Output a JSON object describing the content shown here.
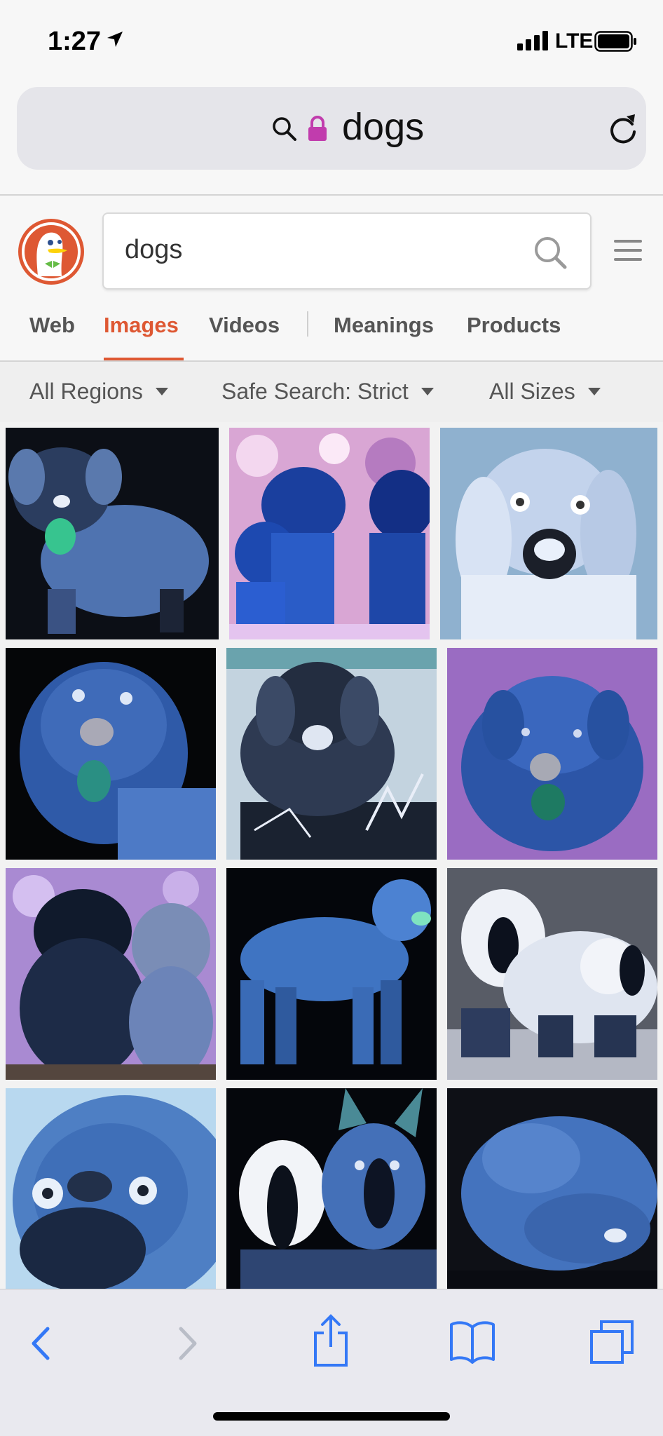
{
  "status_bar": {
    "time": "1:27",
    "network": "LTE"
  },
  "address_bar": {
    "url_text": "dogs",
    "icons": [
      "search-icon",
      "lock-icon",
      "reload-icon"
    ]
  },
  "ddg": {
    "search_value": "dogs",
    "icons": [
      "duckduckgo-logo",
      "search-icon",
      "menu-icon"
    ]
  },
  "tabs": [
    {
      "label": "Web",
      "active": false
    },
    {
      "label": "Images",
      "active": true
    },
    {
      "label": "Videos",
      "active": false
    },
    {
      "label": "Meanings",
      "active": false
    },
    {
      "label": "Products",
      "active": false
    }
  ],
  "filters": [
    {
      "label": "All Regions"
    },
    {
      "label": "Safe Search: Strict"
    },
    {
      "label": "All Sizes"
    }
  ],
  "colors": {
    "accent": "#de5833",
    "lock": "#c13cad",
    "ios_blue": "#3478f6"
  },
  "toolbar": {
    "icons": [
      "back-icon",
      "forward-icon",
      "share-icon",
      "bookmarks-icon",
      "tabs-icon"
    ]
  }
}
